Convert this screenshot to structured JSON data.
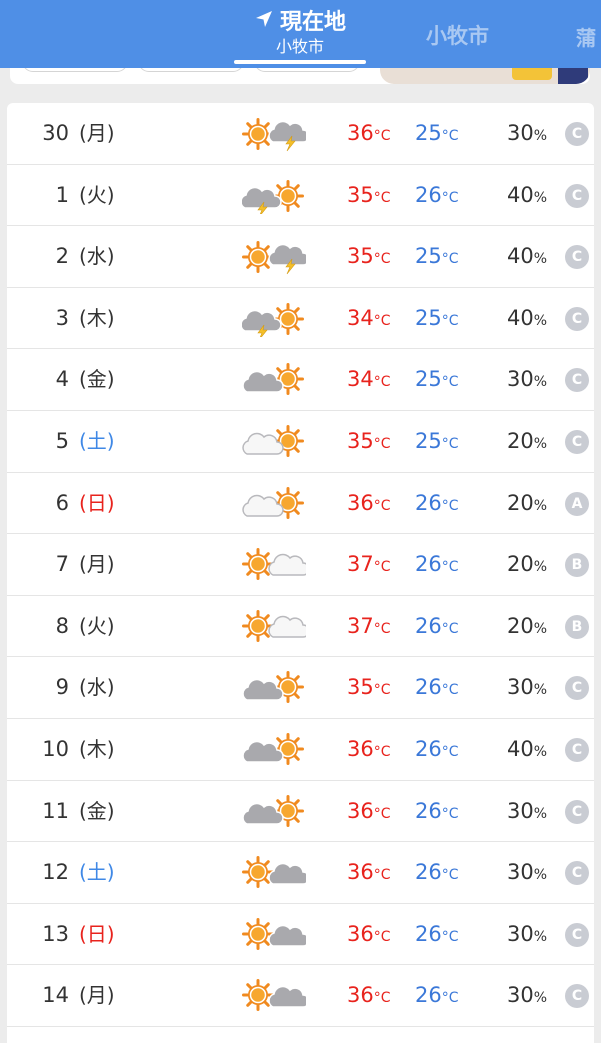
{
  "header": {
    "current_tab_title": "現在地",
    "current_tab_subtitle": "小牧市",
    "other_tab_label": "小牧市",
    "edge_tab_label": "蒲",
    "location_icon": "location-arrow-icon",
    "colors": {
      "bar": "#4f8fe6",
      "active_text": "#ffffff",
      "inactive_text": "#a9c8f2"
    }
  },
  "forecast": {
    "temp_unit": "°C",
    "rain_unit": "%",
    "colors": {
      "high": "#e8231d",
      "low": "#3b78d8",
      "saturday": "#3f88e6",
      "sunday": "#e8231d",
      "grade_badge": "#c9ccd3"
    },
    "days": [
      {
        "day": "30",
        "dow": "(月)",
        "dow_type": "weekday",
        "icon": "sun-then-thunder-cloud",
        "high": "36",
        "low": "25",
        "rain": "30",
        "grade": "C"
      },
      {
        "day": "1",
        "dow": "(火)",
        "dow_type": "weekday",
        "icon": "thunder-cloud-then-sun",
        "high": "35",
        "low": "26",
        "rain": "40",
        "grade": "C"
      },
      {
        "day": "2",
        "dow": "(水)",
        "dow_type": "weekday",
        "icon": "sun-then-thunder-cloud",
        "high": "35",
        "low": "25",
        "rain": "40",
        "grade": "C"
      },
      {
        "day": "3",
        "dow": "(木)",
        "dow_type": "weekday",
        "icon": "thunder-cloud-then-sun",
        "high": "34",
        "low": "25",
        "rain": "40",
        "grade": "C"
      },
      {
        "day": "4",
        "dow": "(金)",
        "dow_type": "weekday",
        "icon": "cloud-then-sun",
        "high": "34",
        "low": "25",
        "rain": "30",
        "grade": "C"
      },
      {
        "day": "5",
        "dow": "(土)",
        "dow_type": "saturday",
        "icon": "light-cloud-then-sun",
        "high": "35",
        "low": "25",
        "rain": "20",
        "grade": "C"
      },
      {
        "day": "6",
        "dow": "(日)",
        "dow_type": "sunday",
        "icon": "light-cloud-then-sun",
        "high": "36",
        "low": "26",
        "rain": "20",
        "grade": "A"
      },
      {
        "day": "7",
        "dow": "(月)",
        "dow_type": "weekday",
        "icon": "sun-then-light-cloud",
        "high": "37",
        "low": "26",
        "rain": "20",
        "grade": "B"
      },
      {
        "day": "8",
        "dow": "(火)",
        "dow_type": "weekday",
        "icon": "sun-then-light-cloud",
        "high": "37",
        "low": "26",
        "rain": "20",
        "grade": "B"
      },
      {
        "day": "9",
        "dow": "(水)",
        "dow_type": "weekday",
        "icon": "cloud-then-sun",
        "high": "35",
        "low": "26",
        "rain": "30",
        "grade": "C"
      },
      {
        "day": "10",
        "dow": "(木)",
        "dow_type": "weekday",
        "icon": "cloud-then-sun",
        "high": "36",
        "low": "26",
        "rain": "40",
        "grade": "C"
      },
      {
        "day": "11",
        "dow": "(金)",
        "dow_type": "weekday",
        "icon": "cloud-then-sun",
        "high": "36",
        "low": "26",
        "rain": "30",
        "grade": "C"
      },
      {
        "day": "12",
        "dow": "(土)",
        "dow_type": "saturday",
        "icon": "sun-then-cloud",
        "high": "36",
        "low": "26",
        "rain": "30",
        "grade": "C"
      },
      {
        "day": "13",
        "dow": "(日)",
        "dow_type": "sunday",
        "icon": "sun-then-cloud",
        "high": "36",
        "low": "26",
        "rain": "30",
        "grade": "C"
      },
      {
        "day": "14",
        "dow": "(月)",
        "dow_type": "weekday",
        "icon": "sun-then-cloud",
        "high": "36",
        "low": "26",
        "rain": "30",
        "grade": "C"
      }
    ]
  }
}
